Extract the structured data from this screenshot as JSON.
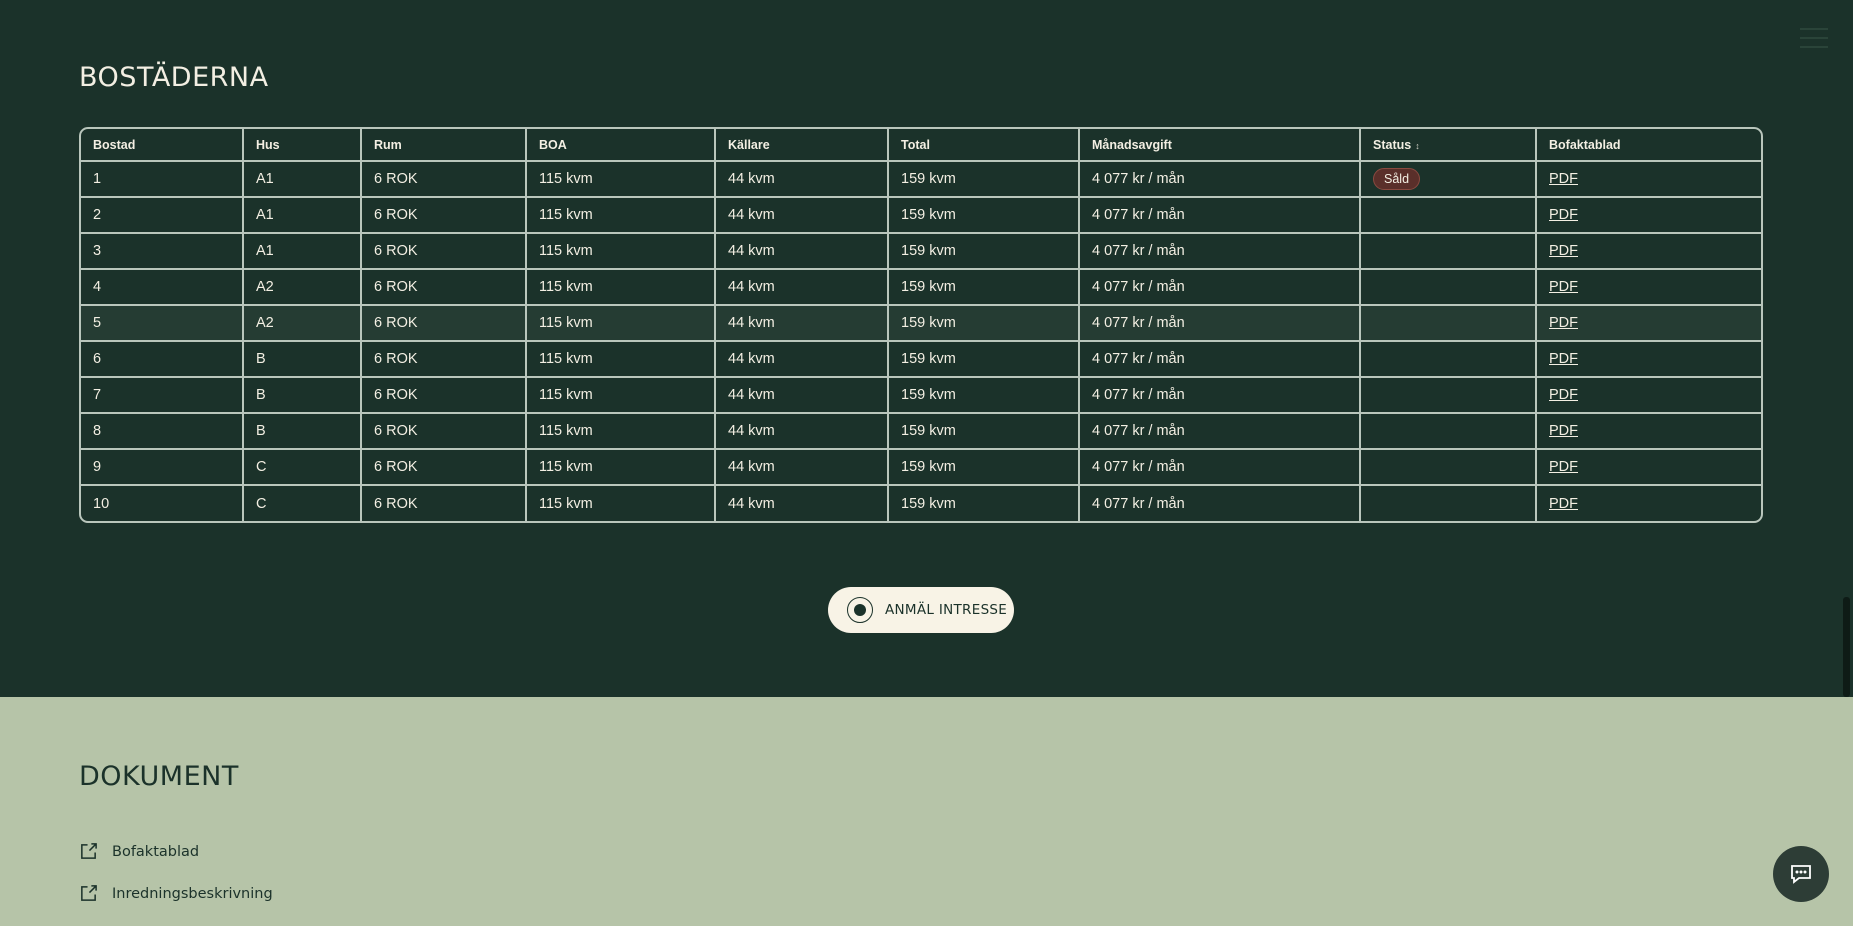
{
  "section_homes": {
    "title": "BOSTÄDERNA",
    "columns": [
      "Bostad",
      "Hus",
      "Rum",
      "BOA",
      "Källare",
      "Total",
      "Månadsavgift",
      "Status",
      "Bofaktablad"
    ],
    "rows": [
      {
        "bostad": "1",
        "hus": "A1",
        "rum": "6 ROK",
        "boa": "115 kvm",
        "kallare": "44 kvm",
        "total": "159 kvm",
        "avgift": "4 077 kr / mån",
        "status": "Såld",
        "pdf": "PDF"
      },
      {
        "bostad": "2",
        "hus": "A1",
        "rum": "6 ROK",
        "boa": "115 kvm",
        "kallare": "44 kvm",
        "total": "159 kvm",
        "avgift": "4 077 kr / mån",
        "status": "",
        "pdf": "PDF"
      },
      {
        "bostad": "3",
        "hus": "A1",
        "rum": "6 ROK",
        "boa": "115 kvm",
        "kallare": "44 kvm",
        "total": "159 kvm",
        "avgift": "4 077 kr / mån",
        "status": "",
        "pdf": "PDF"
      },
      {
        "bostad": "4",
        "hus": "A2",
        "rum": "6 ROK",
        "boa": "115 kvm",
        "kallare": "44 kvm",
        "total": "159 kvm",
        "avgift": "4 077 kr / mån",
        "status": "",
        "pdf": "PDF"
      },
      {
        "bostad": "5",
        "hus": "A2",
        "rum": "6 ROK",
        "boa": "115 kvm",
        "kallare": "44 kvm",
        "total": "159 kvm",
        "avgift": "4 077 kr / mån",
        "status": "",
        "pdf": "PDF"
      },
      {
        "bostad": "6",
        "hus": "B",
        "rum": "6 ROK",
        "boa": "115 kvm",
        "kallare": "44 kvm",
        "total": "159 kvm",
        "avgift": "4 077 kr / mån",
        "status": "",
        "pdf": "PDF"
      },
      {
        "bostad": "7",
        "hus": "B",
        "rum": "6 ROK",
        "boa": "115 kvm",
        "kallare": "44 kvm",
        "total": "159 kvm",
        "avgift": "4 077 kr / mån",
        "status": "",
        "pdf": "PDF"
      },
      {
        "bostad": "8",
        "hus": "B",
        "rum": "6 ROK",
        "boa": "115 kvm",
        "kallare": "44 kvm",
        "total": "159 kvm",
        "avgift": "4 077 kr / mån",
        "status": "",
        "pdf": "PDF"
      },
      {
        "bostad": "9",
        "hus": "C",
        "rum": "6 ROK",
        "boa": "115 kvm",
        "kallare": "44 kvm",
        "total": "159 kvm",
        "avgift": "4 077 kr / mån",
        "status": "",
        "pdf": "PDF"
      },
      {
        "bostad": "10",
        "hus": "C",
        "rum": "6 ROK",
        "boa": "115 kvm",
        "kallare": "44 kvm",
        "total": "159 kvm",
        "avgift": "4 077 kr / mån",
        "status": "",
        "pdf": "PDF"
      }
    ],
    "cta_label": "ANMÄL INTRESSE"
  },
  "section_docs": {
    "title": "DOKUMENT",
    "items": [
      "Bofaktablad",
      "Inredningsbeskrivning"
    ]
  },
  "icons": {
    "menu": "hamburger-menu-icon",
    "sort": "sort-icon",
    "cta_logo": "brand-logo-icon",
    "doc_link": "external-link-icon",
    "chat": "chat-bubble-icon"
  },
  "colors": {
    "dark_green": "#1b322a",
    "sage": "#b6c4a8",
    "cream": "#f8f3e6",
    "sold_badge": "#5a2f2a"
  }
}
